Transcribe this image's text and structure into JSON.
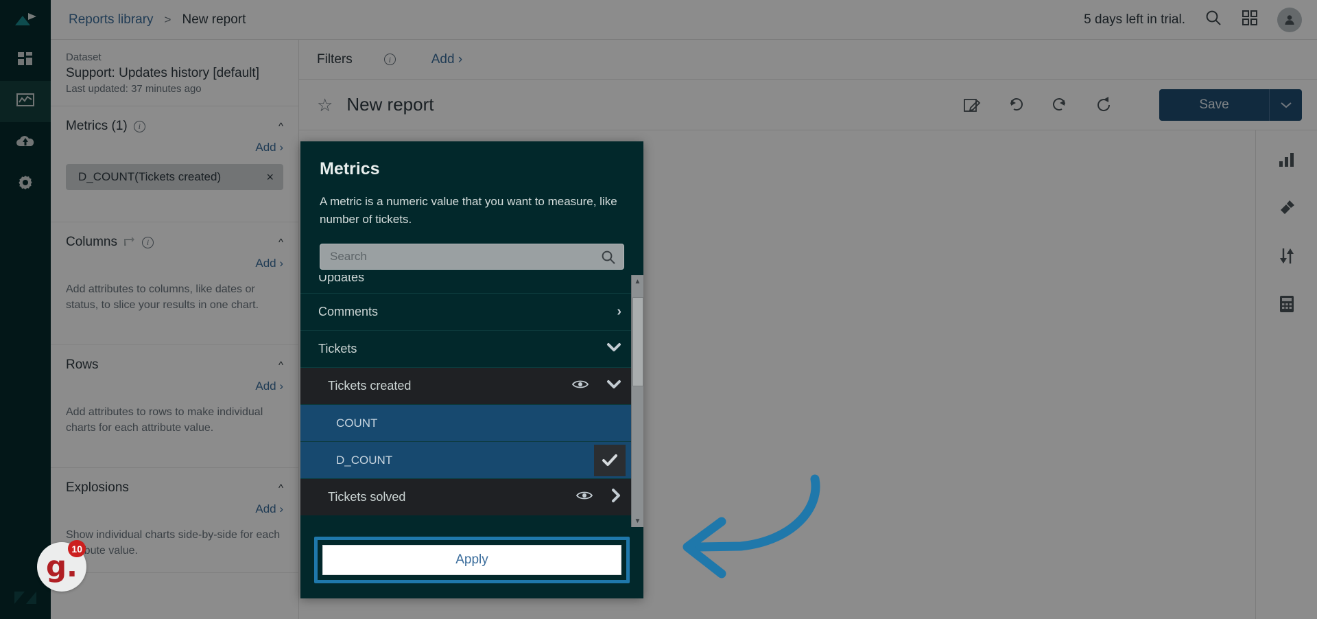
{
  "rail": {
    "items": [
      {
        "name": "logo",
        "icon": "explore-logo-icon"
      },
      {
        "name": "dashboards",
        "icon": "dashboard-grid-icon"
      },
      {
        "name": "reports",
        "icon": "chart-line-icon"
      },
      {
        "name": "datasets",
        "icon": "cloud-upload-icon"
      },
      {
        "name": "admin",
        "icon": "gear-icon"
      }
    ],
    "bottom_icon": "zendesk-logo-icon"
  },
  "topbar": {
    "breadcrumb_root": "Reports library",
    "breadcrumb_sep": ">",
    "breadcrumb_current": "New report",
    "trial_text": "5 days left in trial.",
    "search_icon": "search-icon",
    "apps_icon": "grid-apps-icon",
    "avatar_icon": "user-avatar-icon"
  },
  "left_panel": {
    "dataset_label": "Dataset",
    "dataset_name": "Support: Updates history [default]",
    "dataset_updated": "Last updated: 37 minutes ago",
    "sections": [
      {
        "title": "Metrics (1)",
        "count_suffix": "(1)",
        "add_label": "Add",
        "has_info": true,
        "has_swap": false,
        "pill": {
          "label": "D_COUNT(Tickets created)",
          "remove": "×"
        },
        "hint": ""
      },
      {
        "title": "Columns",
        "add_label": "Add",
        "has_info": true,
        "has_swap": true,
        "pill": null,
        "hint": "Add attributes to columns, like dates or status, to slice your results in one chart."
      },
      {
        "title": "Rows",
        "add_label": "Add",
        "has_info": false,
        "has_swap": false,
        "pill": null,
        "hint": "Add attributes to rows to make individual charts for each attribute value."
      },
      {
        "title": "Explosions",
        "add_label": "Add",
        "has_info": false,
        "has_swap": false,
        "pill": null,
        "hint": "Show individual charts side-by-side for each attribute value."
      }
    ]
  },
  "filter_bar": {
    "title": "Filters",
    "info_icon": "info-icon",
    "add_label": "Add"
  },
  "report_bar": {
    "star_icon": "star-outline-icon",
    "title": "New report",
    "tools": [
      {
        "name": "rename-icon",
        "glyph": "edit-square-icon"
      },
      {
        "name": "undo-icon",
        "glyph": "undo-arrow-icon"
      },
      {
        "name": "redo-icon",
        "glyph": "redo-arrow-icon"
      },
      {
        "name": "refresh-icon",
        "glyph": "refresh-circular-icon"
      }
    ],
    "save_label": "Save",
    "save_caret_icon": "chevron-down-icon"
  },
  "right_tools": [
    {
      "name": "visualization-type-icon",
      "label": "bar-chart-icon"
    },
    {
      "name": "chart-configuration-icon",
      "label": "paintbrush-icon"
    },
    {
      "name": "result-manipulation-icon",
      "label": "sort-arrows-icon"
    },
    {
      "name": "calculations-icon",
      "label": "calculator-icon"
    }
  ],
  "modal": {
    "title": "Metrics",
    "description": "A metric is a numeric value that you want to measure, like number of tickets.",
    "search_placeholder": "Search",
    "search_value": "",
    "search_icon": "search-icon",
    "rows": [
      {
        "label": "Updates",
        "level": "group",
        "state": "clipped",
        "icons": []
      },
      {
        "label": "Comments",
        "level": "group",
        "state": "normal",
        "icons": [
          "chevron-right-icon"
        ]
      },
      {
        "label": "Tickets",
        "level": "group",
        "state": "expanded",
        "icons": [
          "chevron-down-icon"
        ]
      },
      {
        "label": "Tickets created",
        "level": "child",
        "state": "expanded",
        "icons": [
          "eye-icon",
          "chevron-down-icon"
        ]
      },
      {
        "label": "COUNT",
        "level": "child2",
        "state": "normal",
        "icons": []
      },
      {
        "label": "D_COUNT",
        "level": "child2",
        "state": "selected",
        "icons": [
          "check-icon"
        ]
      },
      {
        "label": "Tickets solved",
        "level": "child",
        "state": "normal",
        "icons": [
          "eye-icon",
          "chevron-right-icon"
        ]
      }
    ],
    "apply_label": "Apply",
    "scrollbar": {
      "up_icon": "triangle-up-icon",
      "down_icon": "triangle-down-icon"
    }
  },
  "annotation": {
    "arrow_color": "#1f78ab",
    "highlight_color": "#1f78ab",
    "arrow_icon": "curved-left-arrow-icon"
  },
  "guru_widget": {
    "label": "g.",
    "badge_count": "10"
  },
  "colors": {
    "rail_bg": "#062b2d",
    "modal_bg": "#02282b",
    "selected_row": "#17496f",
    "child_row": "#1f2124",
    "save_button": "#1f4d72",
    "link": "#3b6d9c",
    "badge_red": "#cc1f1f"
  }
}
